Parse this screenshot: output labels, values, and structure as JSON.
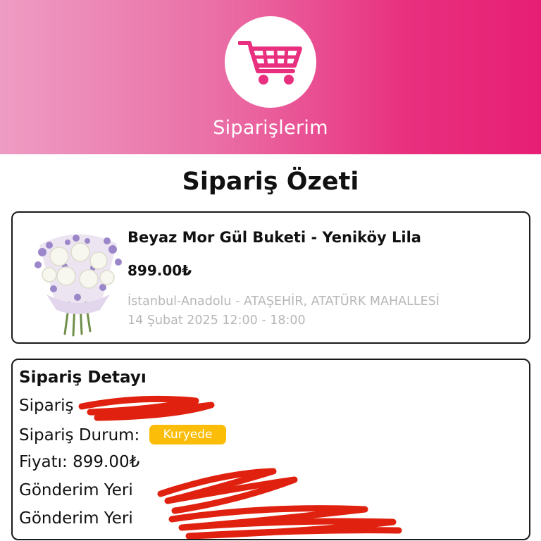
{
  "header": {
    "title": "Siparişlerim",
    "icon": "shopping-cart-icon",
    "gradient_start": "#ee9cc3",
    "gradient_end": "#e71f74",
    "icon_color": "#e8307f"
  },
  "summary": {
    "title": "Sipariş Özeti"
  },
  "product": {
    "name": "Beyaz Mor Gül Buketi - Yeniköy Lila",
    "price": "899.00₺",
    "location": "İstanbul-Anadolu - ATAŞEHİR, ATATÜRK MAHALLESİ",
    "delivery_date": "14 Şubat 2025 12:00 - 18:00"
  },
  "order_detail": {
    "title": "Sipariş Detayı",
    "order_no_label": "Sipariş",
    "status_label": "Sipariş Durum:",
    "status_value": "Kuryede",
    "status_color": "#fbbd08",
    "price_line": "Fiyatı: 899.00₺",
    "address_label_1": "Gönderim Yeri",
    "address_label_2": "Gönderim Yeri"
  },
  "redaction_color": "#e0210f"
}
